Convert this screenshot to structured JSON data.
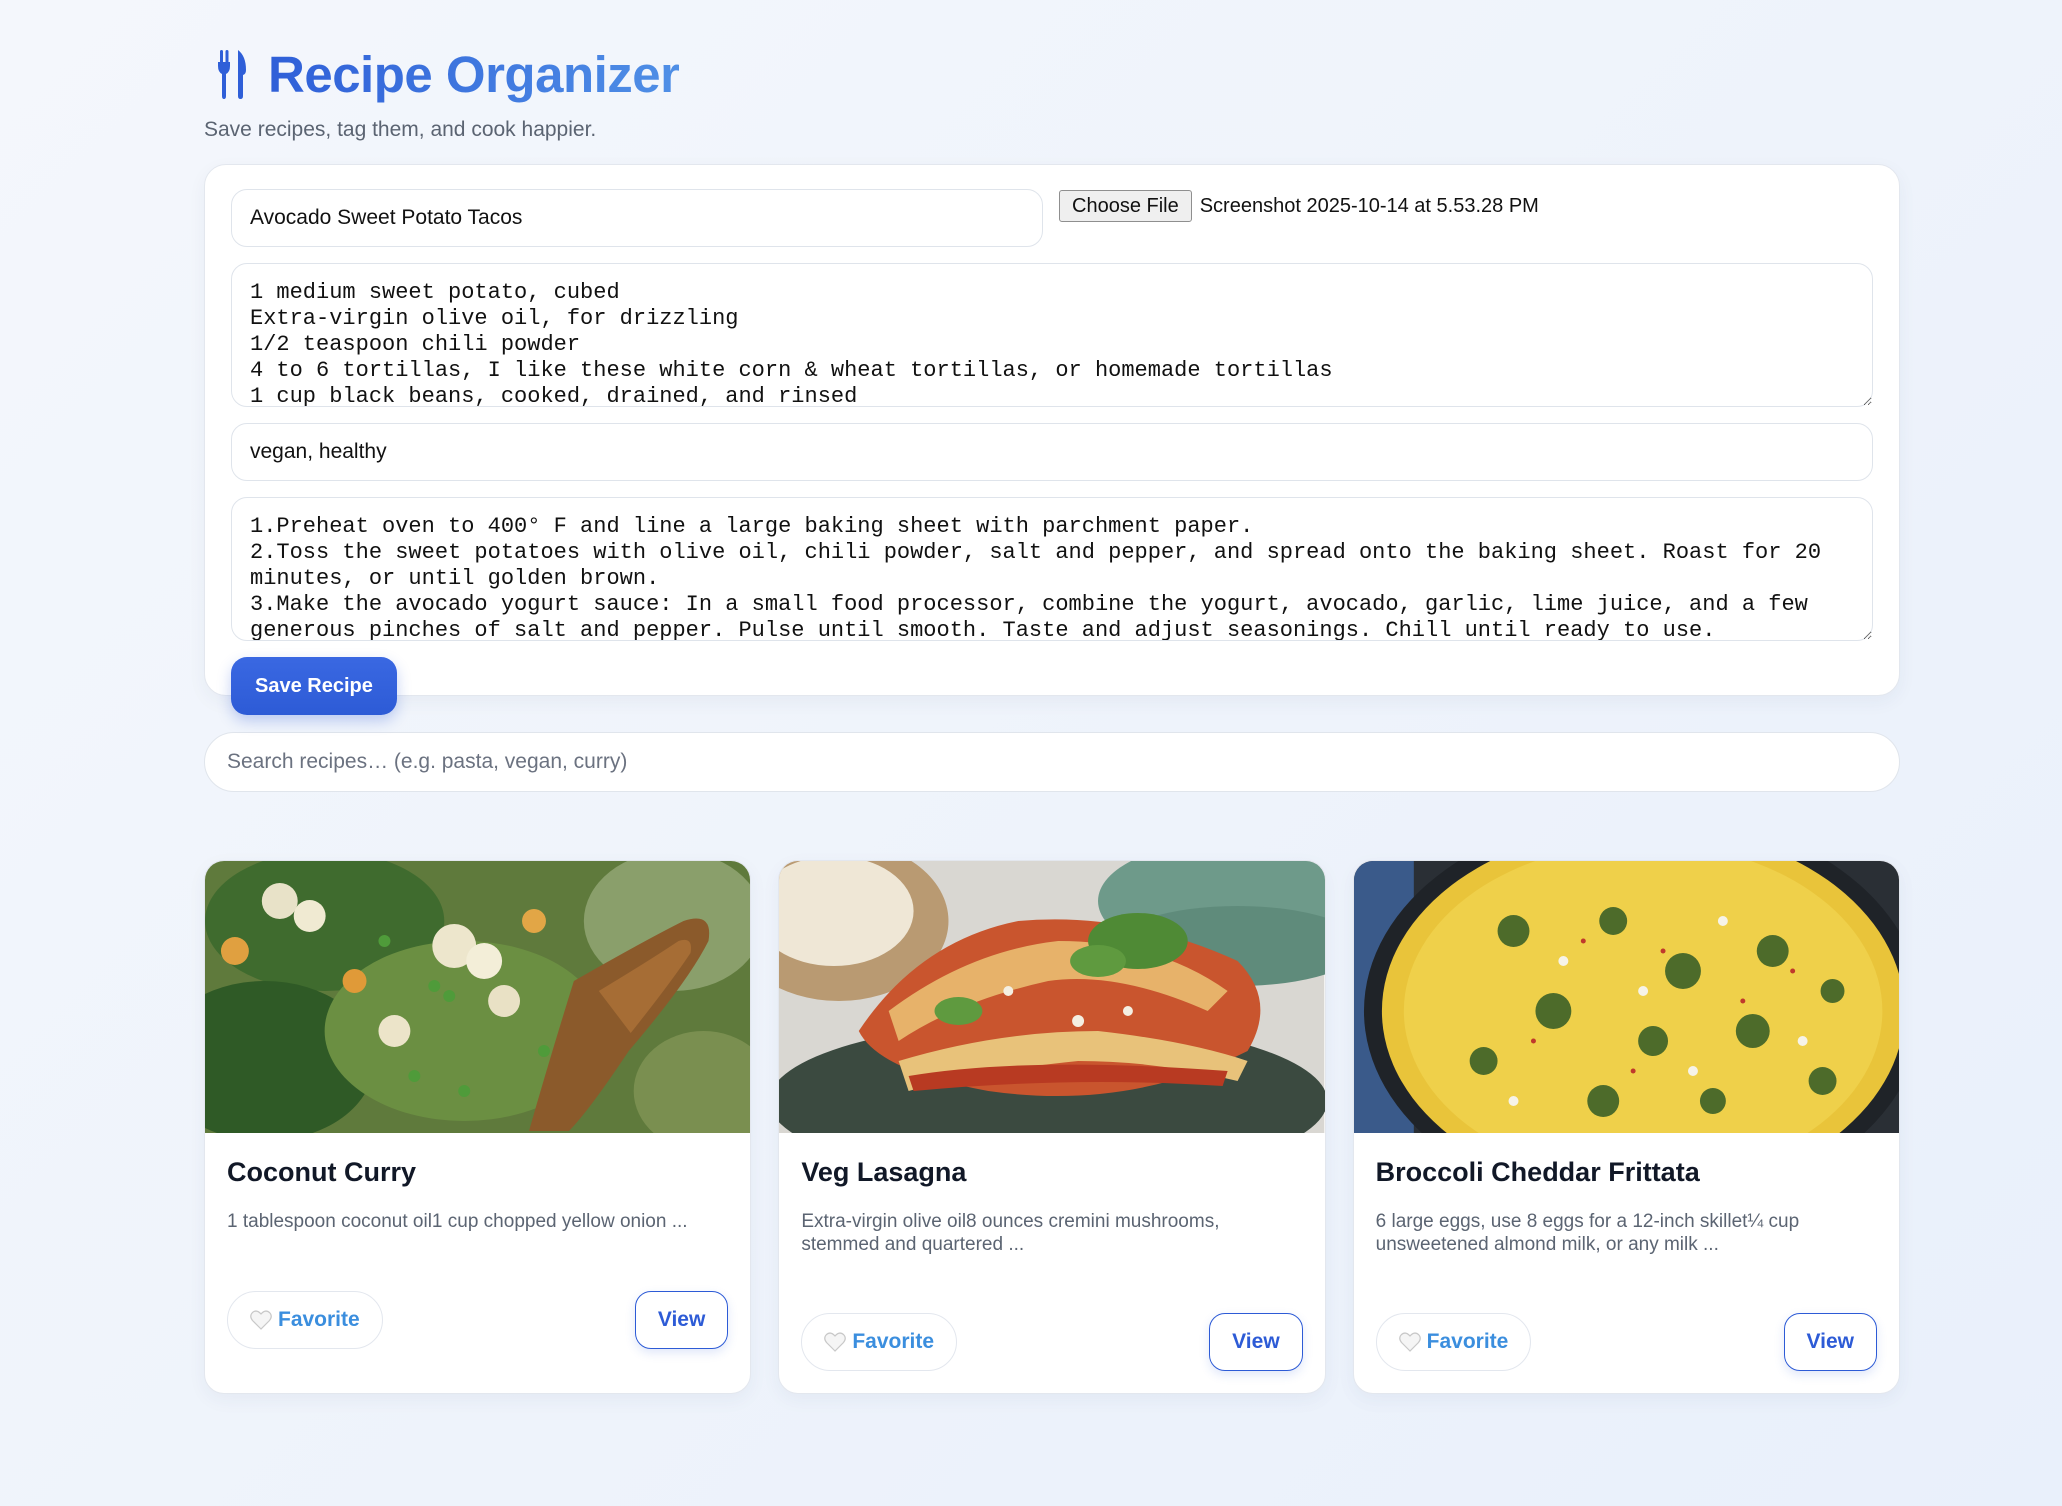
{
  "app": {
    "title": "Recipe Organizer",
    "subtitle": "Save recipes, tag them, and cook happier.",
    "logo_icon": "fork-knife-icon",
    "accent_color": "#2d5bd6"
  },
  "form": {
    "title_value": "Avocado Sweet Potato Tacos",
    "file_button_label": "Choose File",
    "file_name": "Screenshot 2025-10-14 at 5.53.28 PM",
    "ingredients_value": "1 medium sweet potato, cubed\nExtra-virgin olive oil, for drizzling\n1/2 teaspoon chili powder\n4 to 6 tortillas, I like these white corn & wheat tortillas, or homemade tortillas\n1 cup black beans, cooked, drained, and rinsed",
    "tags_value": "vegan, healthy",
    "steps_value": "1.Preheat oven to 400° F and line a large baking sheet with parchment paper.\n2.Toss the sweet potatoes with olive oil, chili powder, salt and pepper, and spread onto the baking sheet. Roast for 20 minutes, or until golden brown.\n3.Make the avocado yogurt sauce: In a small food processor, combine the yogurt, avocado, garlic, lime juice, and a few generous pinches of salt and pepper. Pulse until smooth. Taste and adjust seasonings. Chill until ready to use.",
    "save_label": "Save Recipe"
  },
  "search": {
    "placeholder": "Search recipes… (e.g. pasta, vegan, curry)"
  },
  "recipes": [
    {
      "title": "Coconut Curry",
      "description": "1 tablespoon coconut oil1 cup chopped yellow onion ...",
      "favorite_label": "Favorite",
      "view_label": "View",
      "favorite_icon": "white-heart-icon"
    },
    {
      "title": "Veg Lasagna",
      "description": "Extra-virgin olive oil8 ounces cremini mushrooms, stemmed and quartered ...",
      "favorite_label": "Favorite",
      "view_label": "View",
      "favorite_icon": "white-heart-icon"
    },
    {
      "title": "Broccoli Cheddar Frittata",
      "description": "6 large eggs, use 8 eggs for a 12-inch skillet¼ cup unsweetened almond milk, or any milk ...",
      "favorite_label": "Favorite",
      "view_label": "View",
      "favorite_icon": "white-heart-icon"
    }
  ]
}
